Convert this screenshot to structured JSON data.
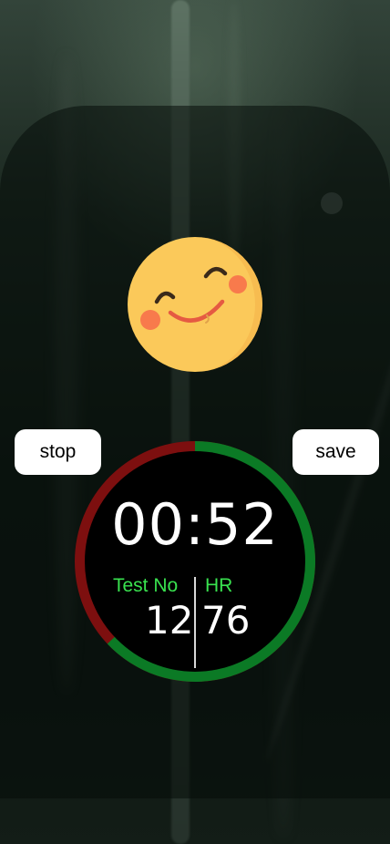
{
  "controls": {
    "stop_label": "stop",
    "save_label": "save"
  },
  "mood": {
    "icon": "smiling-face-icon"
  },
  "timer": {
    "time": "00:52",
    "progress": 0.37,
    "colors": {
      "elapsed": "#0b7a25",
      "remaining": "#7d0f0f",
      "face": "#000000",
      "labels": "#39e24f"
    }
  },
  "stats": {
    "test_label": "Test No",
    "test_value": "12",
    "hr_label": "HR",
    "hr_value": "76"
  }
}
